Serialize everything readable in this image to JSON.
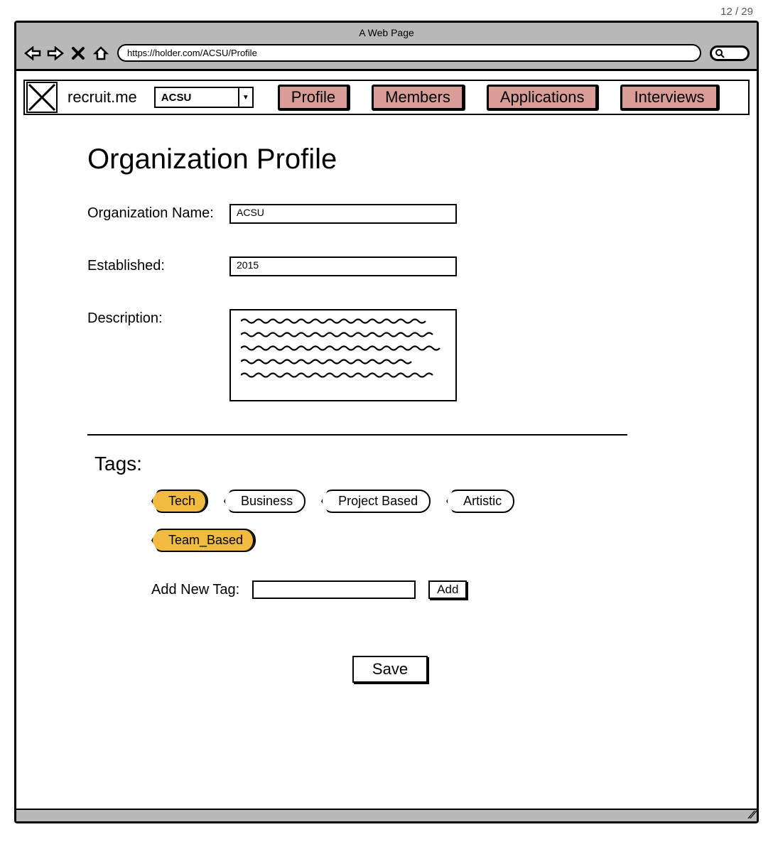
{
  "page_indicator": "12 / 29",
  "browser": {
    "title": "A Web Page",
    "url": "https://holder.com/ACSU/Profile"
  },
  "app": {
    "brand": "recruit.me",
    "org_selected": "ACSU",
    "tabs": [
      "Profile",
      "Members",
      "Applications",
      "Interviews"
    ]
  },
  "page": {
    "title": "Organization Profile",
    "fields": {
      "org_name_label": "Organization Name:",
      "org_name_value": "ACSU",
      "established_label": "Established:",
      "established_value": "2015",
      "description_label": "Description:"
    },
    "tags": {
      "heading": "Tags:",
      "items": [
        {
          "label": "Tech",
          "selected": true
        },
        {
          "label": "Business",
          "selected": false
        },
        {
          "label": "Project Based",
          "selected": false
        },
        {
          "label": "Artistic",
          "selected": false
        },
        {
          "label": "Team_Based",
          "selected": true
        }
      ],
      "add_label": "Add New Tag:",
      "add_button": "Add"
    },
    "save_button": "Save"
  }
}
